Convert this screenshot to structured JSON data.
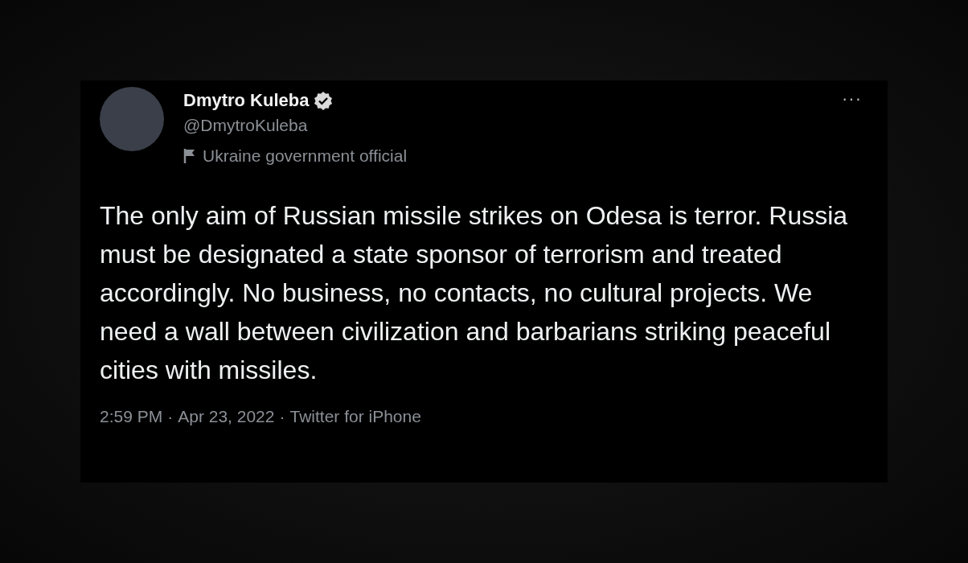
{
  "tweet": {
    "author": {
      "name": "Dmytro Kuleba",
      "verified": true,
      "handle": "@DmytroKuleba",
      "label": "Ukraine government official"
    },
    "more": "···",
    "text": "The only aim of Russian missile strikes on Odesa is terror. Russia must be designated a state sponsor of terrorism and treated accordingly. No business, no contacts, no cultural projects. We need a wall between civilization and barbarians striking peaceful cities with missiles.",
    "time": "2:59 PM",
    "separator_1": "·",
    "date": "Apr 23, 2022",
    "separator_2": "·",
    "source": "Twitter for iPhone"
  }
}
